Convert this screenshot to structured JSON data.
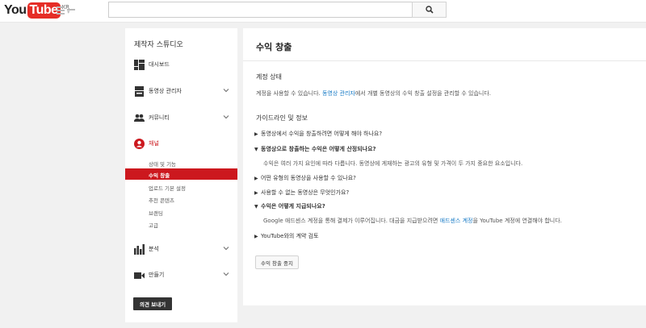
{
  "header": {
    "logo_you": "You",
    "logo_tube": "Tube",
    "region": "KR",
    "search_placeholder": ""
  },
  "sidebar": {
    "title": "제작자 스튜디오",
    "items": [
      {
        "label": "대시보드",
        "icon": "dashboard-icon"
      },
      {
        "label": "동영상 관리자",
        "icon": "video-manager-icon"
      },
      {
        "label": "커뮤니티",
        "icon": "community-icon"
      },
      {
        "label": "채널",
        "icon": "channel-icon"
      },
      {
        "label": "분석",
        "icon": "analytics-icon"
      },
      {
        "label": "만들기",
        "icon": "create-icon"
      }
    ],
    "channel_sub": [
      "상태 및 기능",
      "수익 창출",
      "업로드 기본 설정",
      "추천 콘텐츠",
      "브랜딩",
      "고급"
    ],
    "feedback_button": "의견 보내기"
  },
  "main": {
    "title": "수익 창출",
    "account_status_title": "계정 상태",
    "status_prefix": "계정을 사용할 수 있습니다. ",
    "status_link": "동영상 관리자",
    "status_suffix": "에서 개별 동영상의 수익 창출 설정을 관리할 수 있습니다.",
    "guide_title": "가이드라인 및 정보",
    "faq": [
      {
        "q": "동영상에서 수익을 창출하려면 어떻게 해야 하나요?",
        "open": false
      },
      {
        "q": "동영상으로 창출하는 수익은 어떻게 산정되나요?",
        "open": true
      },
      {
        "q": "어떤 유형의 동영상을 사용할 수 있나요?",
        "open": false
      },
      {
        "q": "사용할 수 없는 동영상은 무엇인가요?",
        "open": false
      },
      {
        "q": "수익은 어떻게 지급되나요?",
        "open": true
      },
      {
        "q": "YouTube와의 계약 검토",
        "open": false
      }
    ],
    "answer1": "수익은 여러 가지 요인에 따라 다릅니다. 동영상에 게재하는 광고의 유형 및 가격이 두 가지 중요한 요소입니다.",
    "answer2_prefix": "Google 애드센스 계정을 통해 결제가 이루어집니다. 대금을 지급받으려면 ",
    "answer2_link": "애드센스 계정",
    "answer2_suffix": "을 YouTube 계정에 연결해야 합니다.",
    "stop_button": "수익 창출 중지"
  },
  "colors": {
    "brand_red": "#cc181e",
    "link_blue": "#167ac6"
  }
}
